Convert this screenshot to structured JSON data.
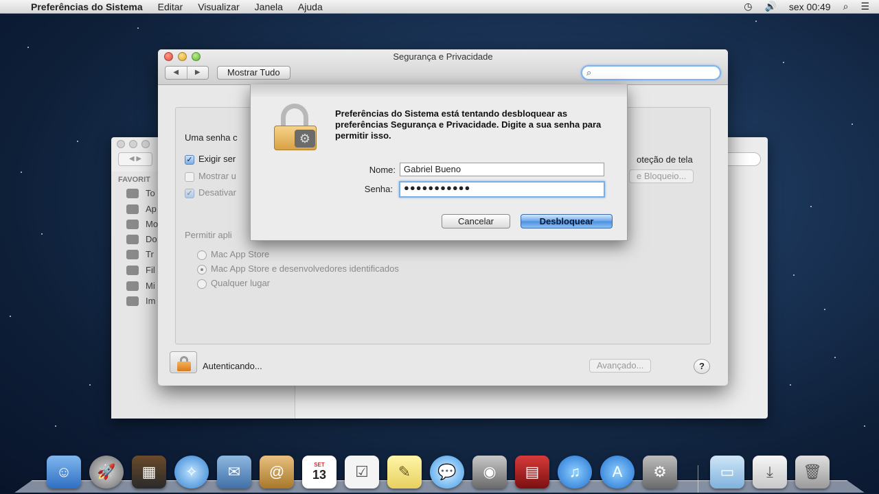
{
  "menubar": {
    "app": "Preferências do Sistema",
    "items": [
      "Editar",
      "Visualizar",
      "Janela",
      "Ajuda"
    ],
    "clock": "sex 00:49"
  },
  "back_window": {
    "favorites_label": "FAVORIT",
    "items": [
      "To",
      "Ap",
      "Mo",
      "Do",
      "Tr",
      "Fil",
      "Mi",
      "Im"
    ]
  },
  "window": {
    "title": "Segurança e Privacidade",
    "show_all": "Mostrar Tudo",
    "search_placeholder": "",
    "panel": {
      "password_text": "Uma senha c",
      "require_label": "Exigir ser",
      "show_label": "Mostrar u",
      "disable_label": "Desativar",
      "screensaver_text": "oteção de tela",
      "lock_button": "e Bloqueio...",
      "allow_apps_label": "Permitir apli",
      "options": [
        "Mac App Store",
        "Mac App Store e desenvolvedores identificados",
        "Qualquer lugar"
      ],
      "selected_option": 1
    },
    "status": "Autenticando...",
    "advanced_button": "Avançado...",
    "help_button": "?"
  },
  "dialog": {
    "message": "Preferências do Sistema está tentando desbloquear as preferências Segurança e Privacidade. Digite a sua senha para permitir isso.",
    "name_label": "Nome:",
    "name_value": "Gabriel Bueno",
    "password_label": "Senha:",
    "password_value": "●●●●●●●●●●●",
    "cancel": "Cancelar",
    "unlock": "Desbloquear"
  },
  "dock": {
    "icons": [
      "finder-icon",
      "launchpad-icon",
      "mission-control-icon",
      "safari-icon",
      "mail-icon",
      "contacts-icon",
      "calendar-icon",
      "reminders-icon",
      "notes-icon",
      "messages-icon",
      "facetime-icon",
      "photo-booth-icon",
      "itunes-icon",
      "app-store-icon",
      "system-preferences-icon",
      "applications-folder-icon",
      "downloads-icon",
      "trash-icon"
    ],
    "calendar_day": "13",
    "calendar_month": "SET"
  }
}
